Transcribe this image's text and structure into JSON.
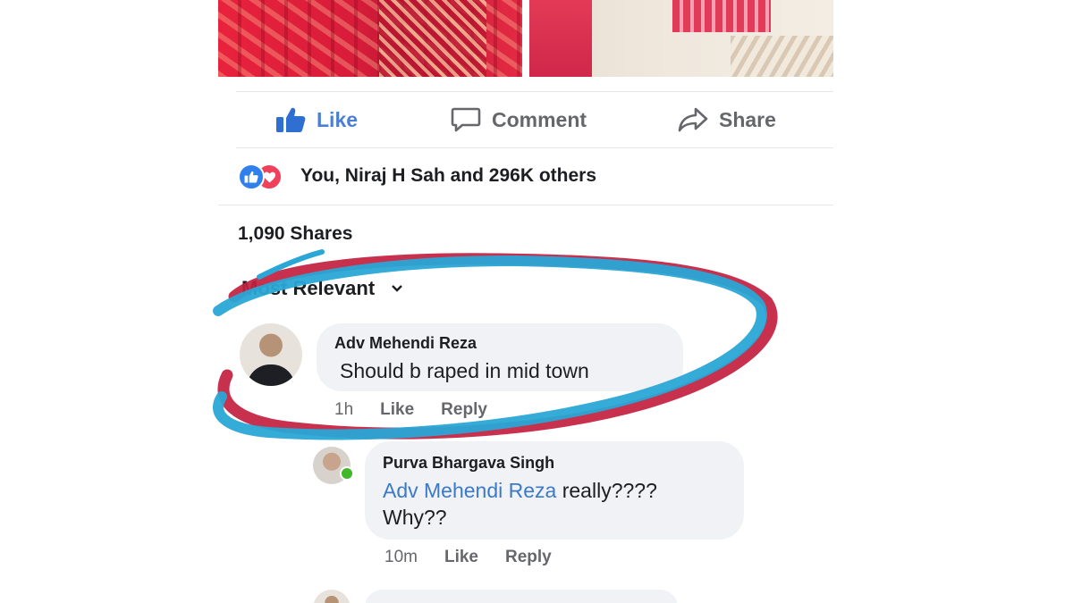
{
  "actions": {
    "like": "Like",
    "comment": "Comment",
    "share": "Share"
  },
  "reactions": {
    "text": "You, Niraj H Sah and 296K others",
    "icons": [
      "like-reaction-icon",
      "love-reaction-icon"
    ]
  },
  "shares_text": "1,090 Shares",
  "sort_label": "Most Relevant",
  "comments": [
    {
      "author": "Adv Mehendi Reza",
      "text": "Should b raped in mid town",
      "time": "1h",
      "like_label": "Like",
      "reply_label": "Reply"
    },
    {
      "author": "Purva Bhargava Singh",
      "mention": "Adv Mehendi Reza",
      "text_after_mention": " really????",
      "text_line2": "Why??",
      "time": "10m",
      "like_label": "Like",
      "reply_label": "Reply"
    }
  ],
  "colors": {
    "like_blue": "#4a7fd4",
    "mention_blue": "#3b79c9",
    "annotation_blue": "#2aa7d6",
    "annotation_red": "#c21f3f"
  }
}
